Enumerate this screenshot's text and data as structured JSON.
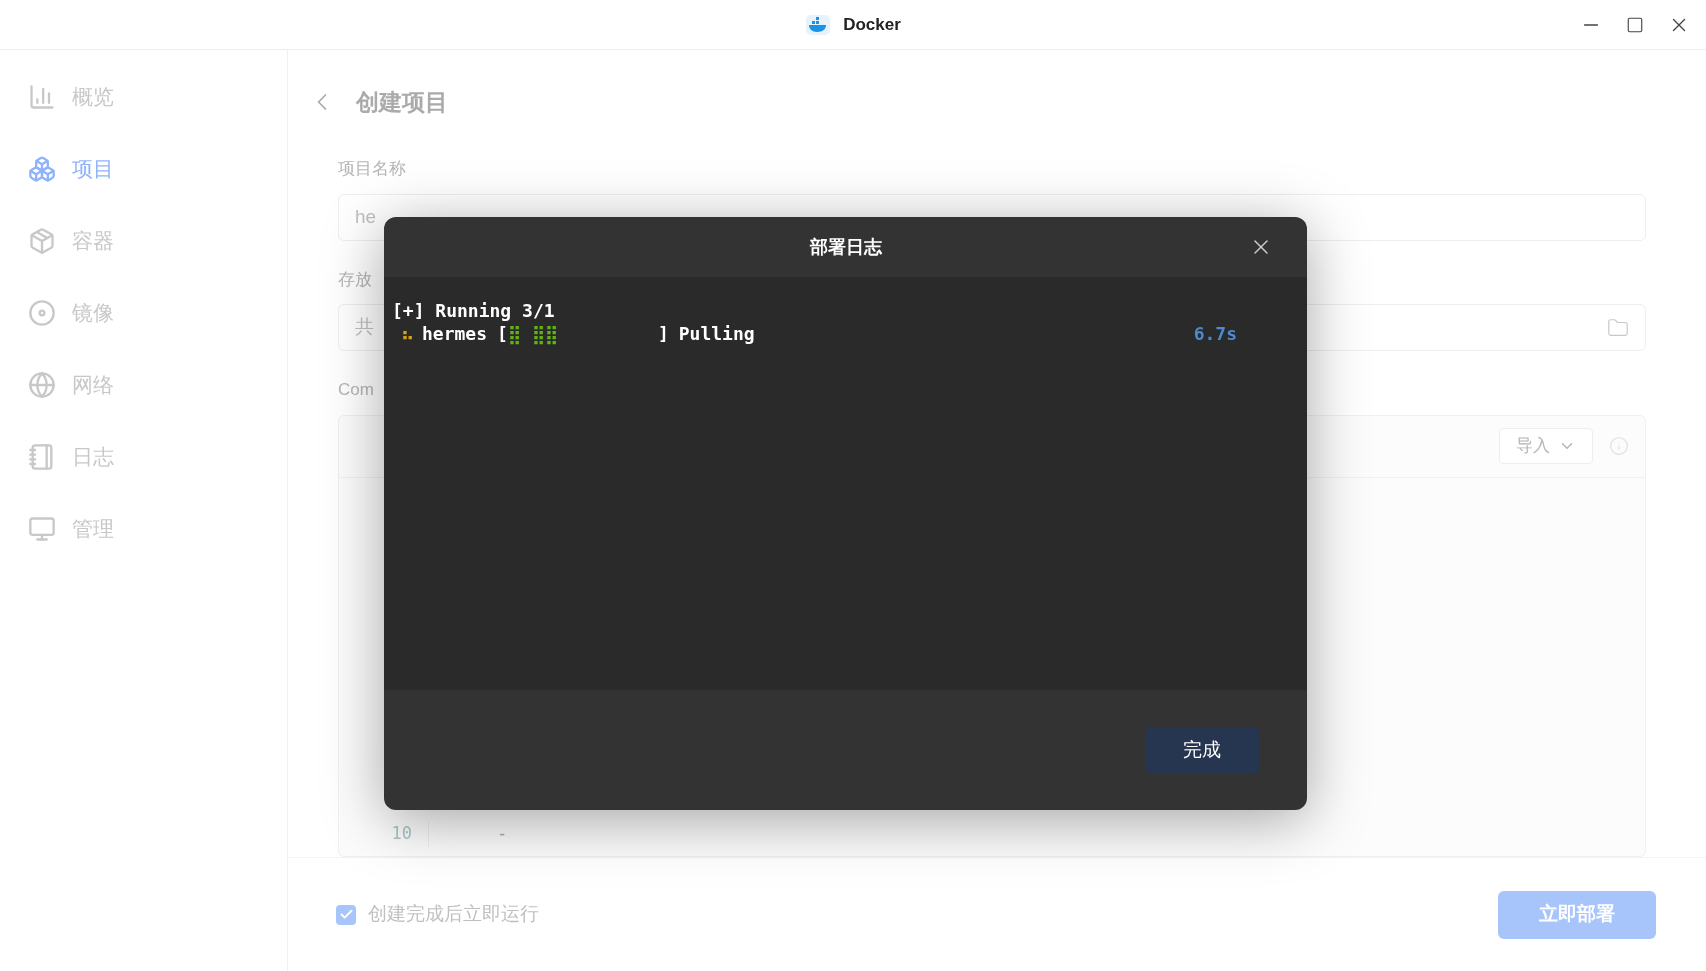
{
  "window": {
    "title": "Docker"
  },
  "sidebar": {
    "items": [
      {
        "label": "概览",
        "selected": false
      },
      {
        "label": "项目",
        "selected": true
      },
      {
        "label": "容器",
        "selected": false
      },
      {
        "label": "镜像",
        "selected": false
      },
      {
        "label": "网络",
        "selected": false
      },
      {
        "label": "日志",
        "selected": false
      },
      {
        "label": "管理",
        "selected": false
      }
    ]
  },
  "page": {
    "title": "创建项目",
    "fields": [
      {
        "label": "项目名称",
        "value": "he",
        "kind": "text"
      },
      {
        "label": "存放",
        "value": "共",
        "kind": "folder"
      }
    ],
    "compose": {
      "label": "Com",
      "import_button": "导入",
      "lines": [
        {
          "number": "10",
          "text": "-"
        }
      ]
    },
    "run_after_create": {
      "label": "创建完成后立即运行",
      "checked": true
    },
    "deploy_button": "立即部署"
  },
  "dialog": {
    "title": "部署日志",
    "log": {
      "header": "[+] Running 3/1",
      "service": {
        "spinner": "⠦",
        "name": "hermes",
        "open": "[",
        "progress": "⣿ ⣿⣿",
        "close": "]",
        "status": "Pulling",
        "time": "6.7s"
      }
    },
    "done_button": "完成"
  }
}
